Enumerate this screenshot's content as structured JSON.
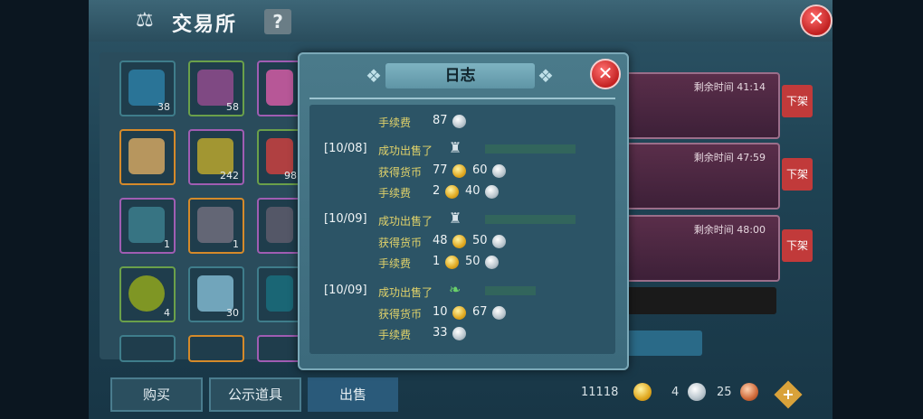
{
  "header": {
    "title": "交易所",
    "help": "?",
    "close": "✕"
  },
  "grid": {
    "counts": [
      "38",
      "58",
      "242",
      "98",
      "1",
      "1",
      "4",
      "30"
    ]
  },
  "listings": [
    {
      "time": "剩余时间 41:14",
      "button": "下架"
    },
    {
      "time": "剩余时间 47:59",
      "button": "下架"
    },
    {
      "time": "剩余时间 48:00",
      "button": "下架"
    }
  ],
  "tabs": [
    "购买",
    "公示道具",
    "出售"
  ],
  "currency": {
    "gold": "11118",
    "silver": "4",
    "copper": "25"
  },
  "dialog": {
    "title": "日志",
    "close": "✕",
    "entries": [
      {
        "fee_label": "手续费",
        "fee": "87"
      },
      {
        "date": "[10/08]",
        "sold_label": "成功出售了",
        "earn_label": "获得货币",
        "earn_gold": "77",
        "earn_silver": "60",
        "fee_label": "手续费",
        "fee_gold": "2",
        "fee_silver": "40"
      },
      {
        "date": "[10/09]",
        "sold_label": "成功出售了",
        "earn_label": "获得货币",
        "earn_gold": "48",
        "earn_silver": "50",
        "fee_label": "手续费",
        "fee_gold": "1",
        "fee_silver": "50"
      },
      {
        "date": "[10/09]",
        "sold_label": "成功出售了",
        "earn_label": "获得货币",
        "earn_gold": "10",
        "earn_silver": "67",
        "fee_label": "手续费",
        "fee_silver": "33"
      }
    ]
  },
  "colors": {
    "accent": "#e2d36a",
    "danger": "#c13a3a",
    "item_green": "#4bd15a"
  }
}
